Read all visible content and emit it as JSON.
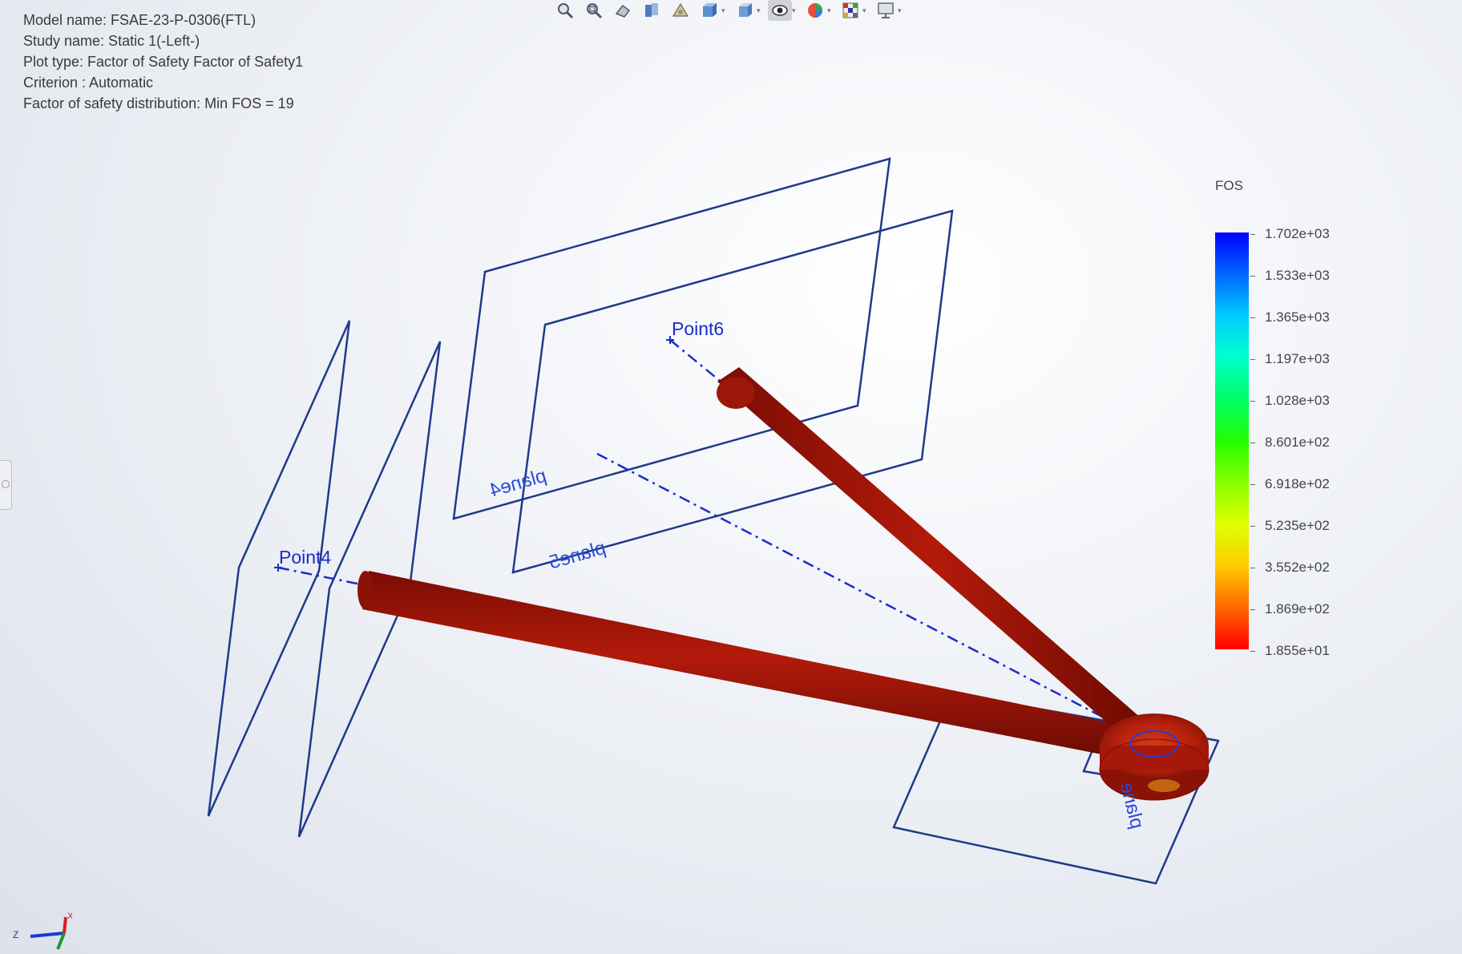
{
  "info": {
    "model_name": "Model name: FSAE-23-P-0306(FTL)",
    "study_name": "Study name: Static 1(-Left-)",
    "plot_type": "Plot type: Factor of Safety Factor of Safety1",
    "criterion": "Criterion : Automatic",
    "distribution": "Factor of safety distribution: Min FOS = 19"
  },
  "toolbar": {
    "icons": [
      "zoom-to-fit-icon",
      "zoom-to-area-icon",
      "previous-view-icon",
      "section-view-icon",
      "view-settings-icon",
      "display-style-icon",
      "view-orientation-icon",
      "hide-show-items-icon",
      "edit-appearance-icon",
      "apply-scene-icon",
      "view-settings-display-icon"
    ]
  },
  "legend": {
    "title": "FOS",
    "ticks": [
      "1.702e+03",
      "1.533e+03",
      "1.365e+03",
      "1.197e+03",
      "1.028e+03",
      "8.601e+02",
      "6.918e+02",
      "5.235e+02",
      "3.552e+02",
      "1.869e+02",
      "1.855e+01"
    ],
    "colors": {
      "max": "#0000ff",
      "min": "#ff0000"
    }
  },
  "scene": {
    "labels": {
      "point6": "Point6",
      "point4": "Point4",
      "plane4": "plane4",
      "plane5": "plane5",
      "plane_b": "plane"
    },
    "colors": {
      "member": "#a01508",
      "plane_edge": "#1e3a8a",
      "axis_line": "#1a2ccc"
    }
  },
  "triad": {
    "z_label": "Z",
    "x_label": "X"
  }
}
